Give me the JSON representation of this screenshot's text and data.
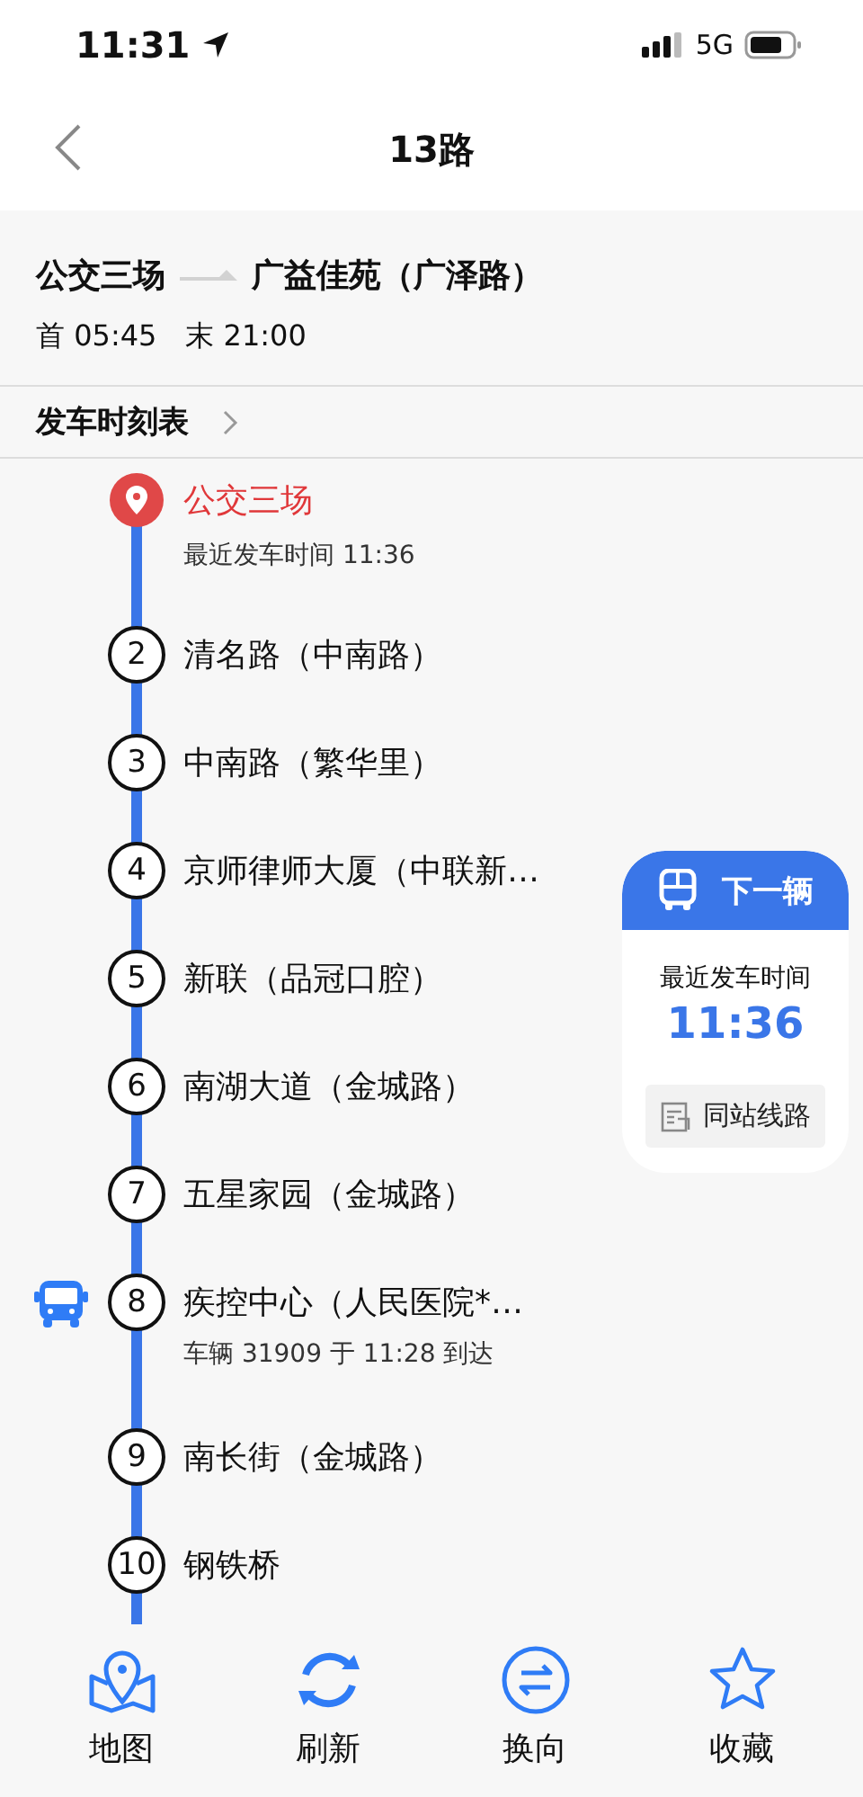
{
  "status_bar": {
    "time": "11:31",
    "network": "5G"
  },
  "nav": {
    "title": "13路"
  },
  "route": {
    "from": "公交三场",
    "to": "广益佳苑（广泽路）",
    "first": "首 05:45",
    "last": "末 21:00"
  },
  "schedule_link": "发车时刻表",
  "stops": [
    {
      "kind": "origin",
      "name": "公交三场",
      "detail": "最近发车时间 11:36",
      "bus_here": false
    },
    {
      "kind": "stop",
      "number": "2",
      "name": "清名路（中南路）",
      "bus_here": false
    },
    {
      "kind": "stop",
      "number": "3",
      "name": "中南路（繁华里）",
      "bus_here": false
    },
    {
      "kind": "stop",
      "number": "4",
      "name": "京师律师大厦（中联新…",
      "bus_here": false
    },
    {
      "kind": "stop",
      "number": "5",
      "name": "新联（品冠口腔）",
      "bus_here": false
    },
    {
      "kind": "stop",
      "number": "6",
      "name": "南湖大道（金城路）",
      "bus_here": false
    },
    {
      "kind": "stop",
      "number": "7",
      "name": "五星家园（金城路）",
      "bus_here": false
    },
    {
      "kind": "stop",
      "number": "8",
      "name": "疾控中心（人民医院*…",
      "detail": "车辆 31909 于 11:28 到达",
      "bus_here": true
    },
    {
      "kind": "stop",
      "number": "9",
      "name": "南长街（金城路）",
      "bus_here": false
    },
    {
      "kind": "stop",
      "number": "10",
      "name": "钢铁桥",
      "bus_here": false
    }
  ],
  "next_bus": {
    "title": "下一辆",
    "label": "最近发车时间",
    "time": "11:36",
    "button": "同站线路"
  },
  "toolbar": [
    {
      "kind": "map",
      "label": "地图"
    },
    {
      "kind": "refresh",
      "label": "刷新"
    },
    {
      "kind": "reverse",
      "label": "换向"
    },
    {
      "kind": "favorite",
      "label": "收藏"
    }
  ]
}
